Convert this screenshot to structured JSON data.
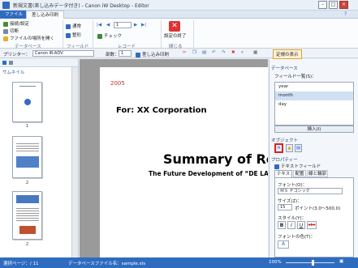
{
  "window": {
    "title": "新規文書(差し込みデータ付き) - Canon iW Desktop - Editor",
    "min": "–",
    "max": "□",
    "close": "×"
  },
  "tabs": [
    "ファイル",
    "差し込み印刷"
  ],
  "ribbon": {
    "db": {
      "connect": "接続/設定",
      "disconnect": "切断",
      "open_file": "ファイルの場所を開く",
      "label": "データベース"
    },
    "field": {
      "normal": "通常",
      "format": "整形",
      "label": "フィールド"
    },
    "record": {
      "value": "1",
      "check": "チェック",
      "label": "レコード"
    },
    "stop": {
      "label": "設定の終了",
      "group": "閉じる"
    }
  },
  "toolbar": {
    "printer_label": "プリンター：",
    "printer": "Canon iR-ADV",
    "copies_label": "部数：",
    "copies": "1",
    "print_btn": "差し込み印刷",
    "ruler": "定規の表示"
  },
  "thumbs": {
    "title": "サムネイル",
    "numbers": [
      "1",
      "2",
      "2"
    ]
  },
  "page": {
    "year": "2005",
    "company": "For: XX Corporation",
    "heading": "Summary of Rese",
    "subheading": "The Future Development of “DE LA C"
  },
  "right": {
    "db_header": "データベース",
    "field_list_label": "フィールド一覧(S)：",
    "fields": [
      "year",
      "month",
      "day"
    ],
    "insert": "挿入(I)",
    "object_label": "オブジェクト",
    "property_label": "プロパティー",
    "textfield": "テキストフィールド",
    "ptabs": [
      "テキスト",
      "配置",
      "線と輪郭"
    ],
    "font_label": "フォント(O)：",
    "font_value": "ＭＳ Ｐゴシック",
    "size_label": "サイズ(Z)：",
    "size_value": "15",
    "size_unit": "ポイント(3.0〜500.0)",
    "style_label": "スタイル(Y)：",
    "style_b": "B",
    "style_i": "I",
    "style_u": "U",
    "style_s": "abc",
    "color_label": "フォントの色(T)：",
    "color_a": "A"
  },
  "status": {
    "page": "選択ページ：/ 11",
    "db_file": "データベースファイル名：sample.xls",
    "zoom": "100%"
  },
  "colors": {
    "accent": "#2f6cc0",
    "highlight": "#e02020"
  }
}
